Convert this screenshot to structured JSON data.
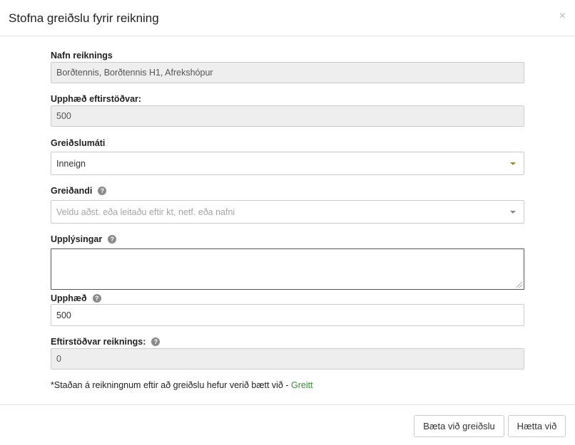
{
  "modal": {
    "title": "Stofna greiðslu fyrir reikning",
    "close": "×"
  },
  "fields": {
    "invoice_name": {
      "label": "Nafn reiknings",
      "value": "Borðtennis, Borðtennis H1, Afrekshópur"
    },
    "outstanding_amount": {
      "label": "Upphæð eftirstöðvar:",
      "value": "500"
    },
    "payment_method": {
      "label": "Greiðslumáti",
      "value": "Inneign"
    },
    "payer": {
      "label": "Greiðandi",
      "placeholder": "Veldu aðst. eða leitaðu eftir kt, netf. eða nafni"
    },
    "info": {
      "label": "Upplýsingar",
      "value": ""
    },
    "amount": {
      "label": "Upphæð",
      "value": "500"
    },
    "balance": {
      "label": "Eftirstöðvar reiknings:",
      "value": "0"
    }
  },
  "note": {
    "text": "*Staðan á reikningnum eftir að greiðslu hefur verið bætt við - ",
    "status": "Greitt"
  },
  "footer": {
    "add_payment_label": "Bæta við greiðslu",
    "cancel_label": "Hætta við"
  },
  "colors": {
    "status_paid": "#3c8d3c",
    "readonly_bg": "#eeeeee"
  },
  "icons": {
    "help": "question-circle-icon",
    "caret": "caret-down-icon"
  }
}
